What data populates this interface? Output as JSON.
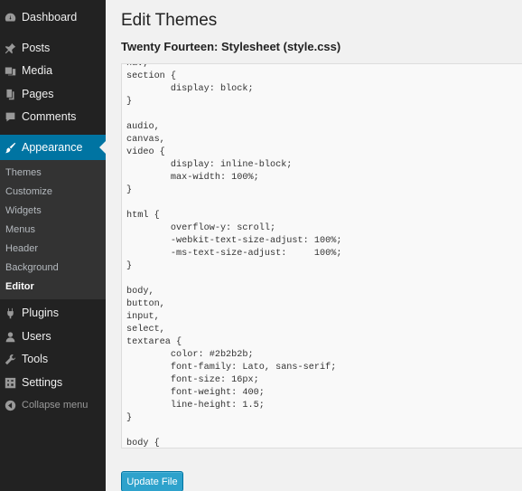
{
  "sidebar": {
    "items": [
      {
        "label": "Dashboard",
        "icon": "dashboard-icon"
      },
      {
        "label": "Posts",
        "icon": "pin-icon"
      },
      {
        "label": "Media",
        "icon": "media-icon"
      },
      {
        "label": "Pages",
        "icon": "pages-icon"
      },
      {
        "label": "Comments",
        "icon": "comment-icon"
      },
      {
        "label": "Appearance",
        "icon": "brush-icon"
      },
      {
        "label": "Plugins",
        "icon": "plug-icon"
      },
      {
        "label": "Users",
        "icon": "user-icon"
      },
      {
        "label": "Tools",
        "icon": "wrench-icon"
      },
      {
        "label": "Settings",
        "icon": "settings-icon"
      },
      {
        "label": "Collapse menu",
        "icon": "collapse-icon"
      }
    ],
    "submenu": [
      "Themes",
      "Customize",
      "Widgets",
      "Menus",
      "Header",
      "Background",
      "Editor"
    ],
    "active_item": "Appearance",
    "current_subitem": "Editor",
    "accent_color": "#0074a2"
  },
  "main": {
    "title": "Edit Themes",
    "file_heading": "Twenty Fourteen: Stylesheet (style.css)",
    "code": "nav,\nsection {\n\tdisplay: block;\n}\n\naudio,\ncanvas,\nvideo {\n\tdisplay: inline-block;\n\tmax-width: 100%;\n}\n\nhtml {\n\toverflow-y: scroll;\n\t-webkit-text-size-adjust: 100%;\n\t-ms-text-size-adjust:     100%;\n}\n\nbody,\nbutton,\ninput,\nselect,\ntextarea {\n\tcolor: #2b2b2b;\n\tfont-family: Lato, sans-serif;\n\tfont-size: 16px;\n\tfont-weight: 400;\n\tline-height: 1.5;\n}\n\nbody {",
    "update_button": "Update File"
  }
}
